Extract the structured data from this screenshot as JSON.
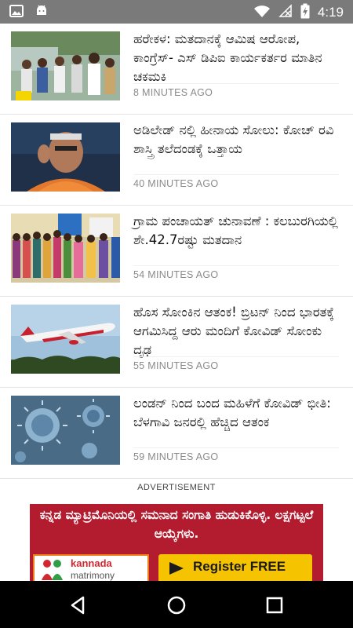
{
  "status_bar": {
    "time": "4:19",
    "left_icons": [
      "image-icon",
      "android-icon"
    ],
    "right_icons": [
      "wifi-icon",
      "no-signal-icon",
      "battery-charging-icon"
    ]
  },
  "news": [
    {
      "title": "ಹರೇಕಳ: ಮತದಾನಕ್ಕೆ ಆಮಿಷ ಆರೋಪ, ಕಾಂಗ್ರೆಸ್- ಎಸ್ ಡಿಪಿಐ ಕಾರ್ಯಕರ್ತರ ಮಾತಿನ ಚಕಮಕಿ",
      "time": "8 MINUTES AGO",
      "image": "crowd-photo"
    },
    {
      "title": "ಅಡಿಲೇಡ್ ನಲ್ಲಿ ಹೀನಾಯ ಸೋಲು: ಕೋಚ್ ರವಿ ಶಾಸ್ತ್ರಿ ತಲೆದಂಡಕ್ಕೆ ಒತ್ತಾಯ",
      "time": "40 MINUTES AGO",
      "image": "coach-photo"
    },
    {
      "title": "ಗ್ರಾಮ ಪಂಚಾಯತ್ ಚುನಾವಣೆ : ಕಲಬುರಗಿಯಲ್ಲಿ ಶೇ.42.7ರಷ್ಟು ಮತದಾನ",
      "time": "54 MINUTES AGO",
      "image": "voters-queue-photo"
    },
    {
      "title": "ಹೊಸ ಸೋಂಕಿನ ಆತಂಕ! ಬ್ರಿಟನ್ ನಿಂದ ಭಾರತಕ್ಕೆ ಆಗಮಿಸಿದ್ದ ಆರು ಮಂದಿಗೆ ಕೋವಿಡ್ ಸೋಂಕು ದೃಢ",
      "time": "55 MINUTES AGO",
      "image": "airplane-photo"
    },
    {
      "title": "ಲಂಡನ್ ನಿಂದ ಬಂದ ಮಹಿಳೆಗೆ ಕೋವಿಡ್ ಭೀತಿ: ಬೆಳಗಾವಿ ಜನರಲ್ಲಿ ಹೆಚ್ಚಿದ ಆತಂಕ",
      "time": "59 MINUTES AGO",
      "image": "virus-photo"
    }
  ],
  "advertisement": {
    "label": "ADVERTISEMENT",
    "headline": "ಕನ್ನಡ ಮ್ಯಾಟ್ರಿಮೊನಿಯಲ್ಲಿ ಸಮನಾದ ಸಂಗಾತಿ ಹುಡುಕಿಕೊಳ್ಳಿ. ಲಕ್ಷಗಟ್ಟಲೆ ಆಯ್ಕೆಗಳು.",
    "logo_name": "kannada",
    "logo_sub": "matrimony",
    "cta": "Register FREE",
    "colors": {
      "background": "#b31b2e",
      "button": "#f6c300",
      "logo_border": "#f07a1a"
    }
  },
  "nav_bar": {
    "buttons": [
      "back-icon",
      "home-icon",
      "recents-icon"
    ]
  }
}
